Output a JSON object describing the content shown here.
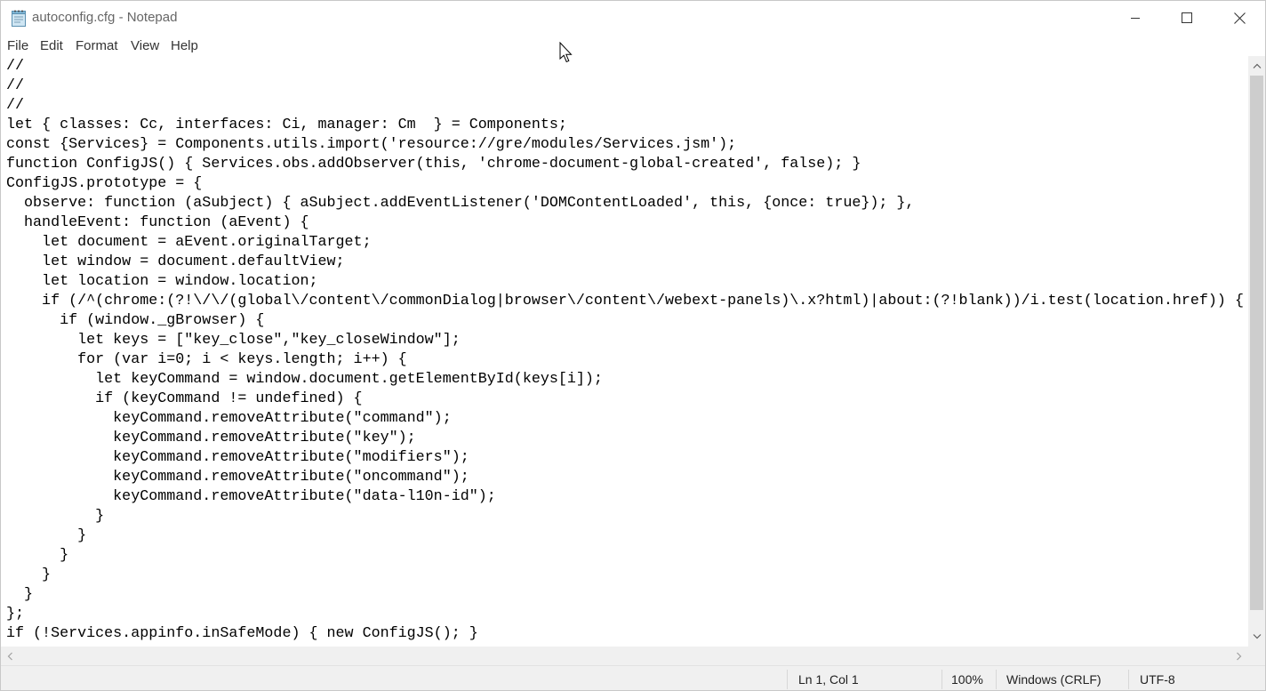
{
  "window": {
    "title": "autoconfig.cfg - Notepad"
  },
  "menu": {
    "items": [
      "File",
      "Edit",
      "Format",
      "View",
      "Help"
    ]
  },
  "editor": {
    "lines": [
      "//",
      "//",
      "//",
      "let { classes: Cc, interfaces: Ci, manager: Cm  } = Components;",
      "const {Services} = Components.utils.import('resource://gre/modules/Services.jsm');",
      "function ConfigJS() { Services.obs.addObserver(this, 'chrome-document-global-created', false); }",
      "ConfigJS.prototype = {",
      "  observe: function (aSubject) { aSubject.addEventListener('DOMContentLoaded', this, {once: true}); },",
      "  handleEvent: function (aEvent) {",
      "    let document = aEvent.originalTarget;",
      "    let window = document.defaultView;",
      "    let location = window.location;",
      "    if (/^(chrome:(?!\\/\\/(global\\/content\\/commonDialog|browser\\/content\\/webext-panels)\\.x?html)|about:(?!blank))/i.test(location.href)) {",
      "      if (window._gBrowser) {",
      "        let keys = [\"key_close\",\"key_closeWindow\"];",
      "        for (var i=0; i < keys.length; i++) {",
      "          let keyCommand = window.document.getElementById(keys[i]);",
      "          if (keyCommand != undefined) {",
      "            keyCommand.removeAttribute(\"command\");",
      "            keyCommand.removeAttribute(\"key\");",
      "            keyCommand.removeAttribute(\"modifiers\");",
      "            keyCommand.removeAttribute(\"oncommand\");",
      "            keyCommand.removeAttribute(\"data-l10n-id\");",
      "          }",
      "        }",
      "      }",
      "    }",
      "  }",
      "};",
      "if (!Services.appinfo.inSafeMode) { new ConfigJS(); }"
    ]
  },
  "status": {
    "position": "Ln 1, Col 1",
    "zoom": "100%",
    "line_ending": "Windows (CRLF)",
    "encoding": "UTF-8"
  },
  "icons": {
    "app": "notepad-icon",
    "minimize": "minimize-icon",
    "maximize": "maximize-icon",
    "close": "close-icon",
    "cursor": "mouse-pointer-icon"
  },
  "colors": {
    "menu_text": "#333333",
    "title_text": "#666666",
    "scroll_bg": "#f0f0f0",
    "scroll_thumb": "#cdcdcd"
  }
}
